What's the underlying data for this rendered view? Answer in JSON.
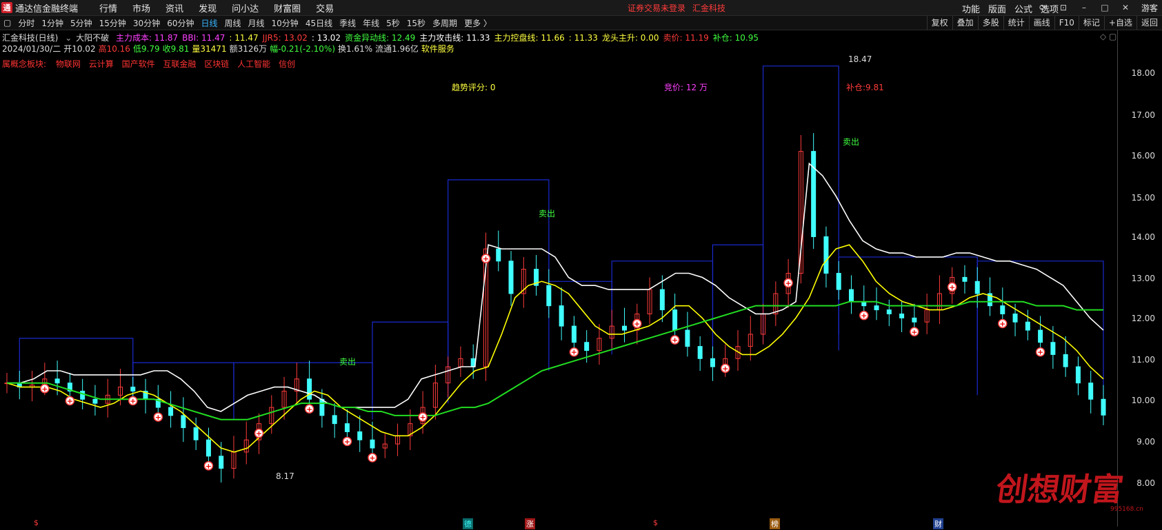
{
  "menubar": {
    "app_title": "通达信金融终端",
    "items": [
      "行情",
      "市场",
      "资讯",
      "发现",
      "问小达",
      "财富圈",
      "交易"
    ],
    "status_login": "证券交易未登录",
    "status_stock": "汇金科技",
    "right_items": [
      "功能",
      "版面",
      "公式",
      "选项"
    ],
    "guest": "游客"
  },
  "periodbar": {
    "periods": [
      "分时",
      "1分钟",
      "5分钟",
      "15分钟",
      "30分钟",
      "60分钟",
      "日线",
      "周线",
      "月线",
      "10分钟",
      "45日线",
      "季线",
      "年线",
      "5秒",
      "15秒",
      "多周期",
      "更多 〉"
    ],
    "active": "日线",
    "tools": [
      "复权",
      "叠加",
      "多股",
      "统计",
      "画线",
      "F10",
      "标记",
      "+自选",
      "返回"
    ]
  },
  "info_line1": {
    "stock": "汇金科技(日线)",
    "signal": "大阳不破",
    "fields": [
      {
        "text": "主力成本: 11.87",
        "color": "#ff40ff"
      },
      {
        "text": "BBI: 11.47",
        "color": "#ff40ff"
      },
      {
        "text": ": 11.47",
        "color": "#ffff40"
      },
      {
        "text": "JJR5: 13.02",
        "color": "#ff3b3b"
      },
      {
        "text": ": 13.02",
        "color": "#ffffff"
      },
      {
        "text": "资金异动线: 12.49",
        "color": "#40ff40"
      },
      {
        "text": "主力攻击线: 11.33",
        "color": "#ffffff"
      },
      {
        "text": "主力控盘线: 11.66",
        "color": "#ffff40"
      },
      {
        "text": ": 11.33",
        "color": "#ffff40"
      },
      {
        "text": "龙头主升: 0.00",
        "color": "#ffff40"
      },
      {
        "text": "卖价: 11.19",
        "color": "#ff3b3b"
      },
      {
        "text": "补仓: 10.95",
        "color": "#40ff40"
      }
    ]
  },
  "info_line2": {
    "fields": [
      {
        "text": "2024/01/30/二",
        "color": "#dddddd"
      },
      {
        "text": "开10.02",
        "color": "#dddddd"
      },
      {
        "text": "高10.16",
        "color": "#ff3b3b"
      },
      {
        "text": "低9.79",
        "color": "#40ff40"
      },
      {
        "text": "收9.81",
        "color": "#40ff40"
      },
      {
        "text": "量31471",
        "color": "#ffff40"
      },
      {
        "text": "额3126万",
        "color": "#dddddd"
      },
      {
        "text": "幅-0.21(-2.10%)",
        "color": "#40ff40"
      },
      {
        "text": "换1.61%",
        "color": "#dddddd"
      },
      {
        "text": "流通1.96亿",
        "color": "#dddddd"
      },
      {
        "text": "软件服务",
        "color": "#ffff40"
      }
    ]
  },
  "concepts": {
    "label": "属概念板块:",
    "items": [
      "物联网",
      "云计算",
      "国产软件",
      "互联金融",
      "区块链",
      "人工智能",
      "信创"
    ]
  },
  "annotations": {
    "trend_score": "趋势评分:  0",
    "auction": "竞价: 12 万",
    "buchang": "补仓:9.81",
    "max_label": "18.47",
    "min_label": "8.17",
    "sell1": "卖出",
    "sell2": "卖出",
    "sell3": "卖出"
  },
  "yaxis": {
    "ticks": [
      "18.00",
      "17.00",
      "16.00",
      "15.00",
      "14.00",
      "13.00",
      "12.00",
      "11.00",
      "10.00",
      "9.00",
      "8.00"
    ]
  },
  "bottom_marks": [
    {
      "text": "$",
      "color": "#ff3b3b"
    },
    {
      "text": "德",
      "color": "#40ffff",
      "bg": "#0a6a6a"
    },
    {
      "text": "涨",
      "color": "#ffffff",
      "bg": "#a01818"
    },
    {
      "text": "$",
      "color": "#ff3b3b"
    },
    {
      "text": "榜",
      "color": "#ffffff",
      "bg": "#9a5a10"
    },
    {
      "text": "财",
      "color": "#ffffff",
      "bg": "#204090"
    }
  ],
  "watermark": {
    "text": "创想财富",
    "url": "995168.cn"
  },
  "colors": {
    "up": "#ff3b3b",
    "down": "#40ffff",
    "ma_yellow": "#ffff00",
    "ma_green": "#22dd22",
    "ma_white": "#ffffff",
    "ma_red": "#ff2020",
    "ma_magenta": "#ff40ff",
    "box_blue": "#1a2ad0"
  },
  "chart_data": {
    "type": "line",
    "ylim": [
      8.0,
      18.6
    ],
    "max_price": 18.47,
    "min_price": 8.17,
    "series": [
      {
        "color_key": "price",
        "values": [
          10.6,
          10.5,
          10.55,
          10.7,
          10.6,
          10.4,
          10.2,
          10.1,
          10.3,
          10.5,
          10.4,
          10.2,
          10.0,
          9.8,
          9.5,
          9.2,
          8.8,
          8.5,
          8.9,
          9.2,
          9.6,
          10.0,
          10.4,
          10.7,
          10.2,
          9.8,
          9.6,
          9.4,
          9.2,
          9.0,
          9.1,
          9.3,
          9.6,
          10.0,
          10.6,
          11.0,
          11.2,
          11.0,
          13.9,
          13.6,
          12.8,
          13.4,
          13.0,
          12.5,
          12.0,
          11.6,
          11.4,
          11.7,
          12.0,
          11.9,
          12.3,
          12.9,
          12.4,
          11.9,
          11.5,
          11.2,
          11.0,
          11.2,
          11.5,
          11.8,
          12.3,
          12.8,
          13.3,
          16.3,
          14.2,
          13.3,
          12.9,
          12.6,
          12.5,
          12.4,
          12.3,
          12.2,
          12.1,
          12.4,
          12.8,
          13.2,
          13.1,
          12.8,
          12.5,
          12.3,
          12.1,
          11.9,
          11.6,
          11.3,
          11.0,
          10.6,
          10.2,
          9.81
        ]
      },
      {
        "color_key": "ma_white",
        "values": [
          10.6,
          10.6,
          10.7,
          10.9,
          10.9,
          10.8,
          10.8,
          10.8,
          10.8,
          10.8,
          10.8,
          10.9,
          10.9,
          10.7,
          10.4,
          10.0,
          9.9,
          10.1,
          10.3,
          10.4,
          10.5,
          10.5,
          10.4,
          10.3,
          10.1,
          10.0,
          10.0,
          10.0,
          10.0,
          10.0,
          10.2,
          10.7,
          10.8,
          10.9,
          11.0,
          11.0,
          14.0,
          13.9,
          13.9,
          13.9,
          13.9,
          13.7,
          13.2,
          13.0,
          13.0,
          12.9,
          12.9,
          12.9,
          12.9,
          13.1,
          13.3,
          13.3,
          13.2,
          13.0,
          12.7,
          12.5,
          12.3,
          12.3,
          12.4,
          12.6,
          16.0,
          15.7,
          15.2,
          14.6,
          14.1,
          13.9,
          13.8,
          13.8,
          13.7,
          13.7,
          13.7,
          13.8,
          13.8,
          13.7,
          13.6,
          13.6,
          13.5,
          13.4,
          13.2,
          13.0,
          12.6,
          12.2,
          11.9
        ]
      },
      {
        "color_key": "ma_yellow",
        "values": [
          10.6,
          10.5,
          10.5,
          10.5,
          10.4,
          10.2,
          10.1,
          10.0,
          10.1,
          10.3,
          10.4,
          10.3,
          10.1,
          9.9,
          9.6,
          9.3,
          9.0,
          8.9,
          9.0,
          9.3,
          9.6,
          9.9,
          10.2,
          10.4,
          10.3,
          10.0,
          9.8,
          9.6,
          9.4,
          9.3,
          9.3,
          9.5,
          9.8,
          10.2,
          10.6,
          10.9,
          11.0,
          11.8,
          12.7,
          13.0,
          13.1,
          13.0,
          12.8,
          12.4,
          12.0,
          11.8,
          11.8,
          11.9,
          12.0,
          12.2,
          12.5,
          12.5,
          12.2,
          11.8,
          11.5,
          11.3,
          11.3,
          11.5,
          11.8,
          12.2,
          12.7,
          13.5,
          13.9,
          14.0,
          13.6,
          13.1,
          12.8,
          12.6,
          12.5,
          12.4,
          12.4,
          12.5,
          12.7,
          12.8,
          12.7,
          12.5,
          12.3,
          12.1,
          11.9,
          11.7,
          11.4,
          11.0,
          10.7
        ]
      },
      {
        "color_key": "ma_green",
        "values": [
          10.6,
          10.6,
          10.6,
          10.6,
          10.5,
          10.4,
          10.3,
          10.2,
          10.2,
          10.2,
          10.2,
          10.2,
          10.1,
          10.0,
          9.9,
          9.8,
          9.7,
          9.7,
          9.7,
          9.8,
          9.9,
          10.0,
          10.1,
          10.1,
          10.1,
          10.0,
          10.0,
          9.9,
          9.9,
          9.8,
          9.8,
          9.8,
          9.8,
          9.9,
          10.0,
          10.0,
          10.1,
          10.3,
          10.5,
          10.7,
          10.9,
          11.0,
          11.1,
          11.2,
          11.3,
          11.4,
          11.5,
          11.6,
          11.7,
          11.8,
          11.9,
          12.0,
          12.1,
          12.2,
          12.3,
          12.4,
          12.5,
          12.5,
          12.5,
          12.5,
          12.5,
          12.5,
          12.5,
          12.6,
          12.6,
          12.6,
          12.5,
          12.5,
          12.5,
          12.5,
          12.5,
          12.5,
          12.6,
          12.6,
          12.6,
          12.6,
          12.6,
          12.5,
          12.5,
          12.5,
          12.4,
          12.4,
          12.4
        ]
      }
    ]
  }
}
